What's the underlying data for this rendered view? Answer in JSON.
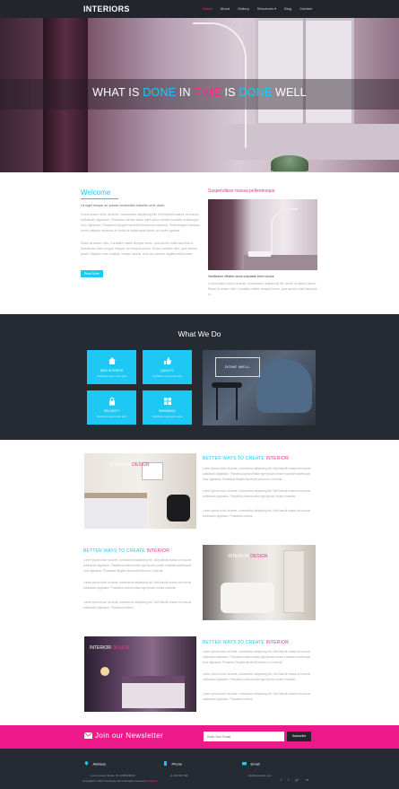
{
  "header": {
    "logo": "INTERIORS",
    "nav": [
      "Home",
      "About",
      "Gallery",
      "Structures ▾",
      "Blog",
      "Contact"
    ]
  },
  "hero": {
    "parts": [
      {
        "text": "WHAT IS ",
        "style": "white"
      },
      {
        "text": "DONE",
        "style": "blue"
      },
      {
        "text": " IN ",
        "style": "white"
      },
      {
        "text": "TIME",
        "style": "pink"
      },
      {
        "text": " IS ",
        "style": "white"
      },
      {
        "text": "DONE",
        "style": "blue"
      },
      {
        "text": "  WELL",
        "style": "white"
      }
    ]
  },
  "welcome": {
    "title": "Welcome",
    "lead": "Ut eget neque ac ipsum venenatis lobortis ut et dolor.",
    "p1": "Lorem ipsum dolor sit amet, consectetur adipiscing elit. Sed blandit massa vel mauris sollicitudin dignissim. Phasellus ultrices tellus eget ipsum ornare molestie scelerisque eros dignissim. Phasellus fringilla hendrerit lectus nec vehicula. Pellentesque habitant morbi tristique senectus et netus et malesuada fames ac turpis egestas.",
    "p2": "Etiam at auctor nibh. Curabitur mattis tempus lorem, quis auctor nulla faucibus in. Maecenas vitae congue magna, vel tempus lectus. Donec sodales nibh, quis lacinia quam. Aliquam erat volutpat. Integer lacinia, eros ac posuere sagittis tellus tortor.",
    "button": "Read More"
  },
  "side": {
    "title": "Suspendisse massa pellentesque",
    "caption": "Vestibulum efficitur lacus vulputate lorem luctus",
    "text": "Lorem ipsum dolor sit amet, consectetur adipiscing elit. Morbi ut dictum quam. Etiam at auctor nibh. Curabitur mattis tempus lorem, quis auctor nulla faucibus in."
  },
  "whatwedo": {
    "title": "What We Do",
    "tiles": [
      {
        "title": "NEW INTERIOR",
        "sub": "Vestibulum eget tortor ante"
      },
      {
        "title": "QUALITY",
        "sub": "Vestibulum eget tortor ante"
      },
      {
        "title": "SECURITY",
        "sub": "Vestibulum eget tortor ante"
      },
      {
        "title": "BRANDING",
        "sub": "Vestibulum eget tortor ante"
      }
    ],
    "image_caption": "DONE WELL"
  },
  "features": [
    {
      "title_a": "BETTER WAYS TO CREATE",
      "title_b": "INTERIOR",
      "img_a": "INTERIOR",
      "img_b": "DESIGN",
      "p1": "Lorem ipsum dolor sit amet, consectetur adipiscing elit. Sed blandit massa vel mauris sollicitudin dignissim. Phasellus ultrices tellus eget ipsum ornare molestie scelerisque eros dignissim. Phasellus fringilla hendrerit lectus nec vehicula.",
      "p2": "Lorem ipsum dolor sit amet, consectetur adipiscing elit. Sed blandit massa vel mauris sollicitudin dignissim. Phasellus ultrices tellus eget ipsum ornare molestie.",
      "p3": "Lorem ipsum dolor sit amet, consectetur adipiscing elit. Sed blandit massa vel mauris sollicitudin dignissim. Phasellus ultrices."
    },
    {
      "title_a": "BETTER WAYS TO CREATE",
      "title_b": "INTERIOR",
      "img_a": "INTERIOR",
      "img_b": "DESIGN",
      "p1": "Lorem ipsum dolor sit amet, consectetur adipiscing elit. Sed blandit massa vel mauris sollicitudin dignissim. Phasellus ultrices tellus eget ipsum ornare molestie scelerisque eros dignissim. Phasellus fringilla hendrerit lectus nec vehicula.",
      "p2": "Lorem ipsum dolor sit amet, consectetur adipiscing elit. Sed blandit massa vel mauris sollicitudin dignissim. Phasellus ultrices tellus eget ipsum ornare molestie.",
      "p3": "Lorem ipsum dolor sit amet, consectetur adipiscing elit. Sed blandit massa vel mauris sollicitudin dignissim. Phasellus ultrices."
    },
    {
      "title_a": "BETTER WAYS TO CREATE",
      "title_b": "INTERIOR",
      "img_a": "INTERIOR",
      "img_b": "DESIGN",
      "p1": "Lorem ipsum dolor sit amet, consectetur adipiscing elit. Sed blandit massa vel mauris sollicitudin dignissim. Phasellus ultrices tellus eget ipsum ornare molestie scelerisque eros dignissim. Phasellus fringilla hendrerit lectus nec vehicula.",
      "p2": "Lorem ipsum dolor sit amet, consectetur adipiscing elit. Sed blandit massa vel mauris sollicitudin dignissim. Phasellus ultrices tellus eget ipsum ornare molestie.",
      "p3": "Lorem ipsum dolor sit amet, consectetur adipiscing elit. Sed blandit massa vel mauris sollicitudin dignissim. Phasellus ultrices."
    }
  ],
  "newsletter": {
    "title": "Join our Newsletter",
    "placeholder": "Enter Your Email",
    "button": "Subscribe"
  },
  "footer": {
    "address_title": "Address",
    "address": "Lorem Ipsum Street, PL 12345 ABCD",
    "phone_title": "Phone",
    "phone": "+1 234 567 890",
    "email_title": "Email",
    "email": "info@example.com",
    "copyright_a": "Copyright © 2017 Company name All rights reserved |",
    "copyright_b": "Interiors",
    "social": [
      "f",
      "t",
      "g+",
      "in"
    ]
  },
  "colors": {
    "accent_blue": "#1ec8f5",
    "accent_pink": "#ee1a8b",
    "dark": "#262a33"
  }
}
